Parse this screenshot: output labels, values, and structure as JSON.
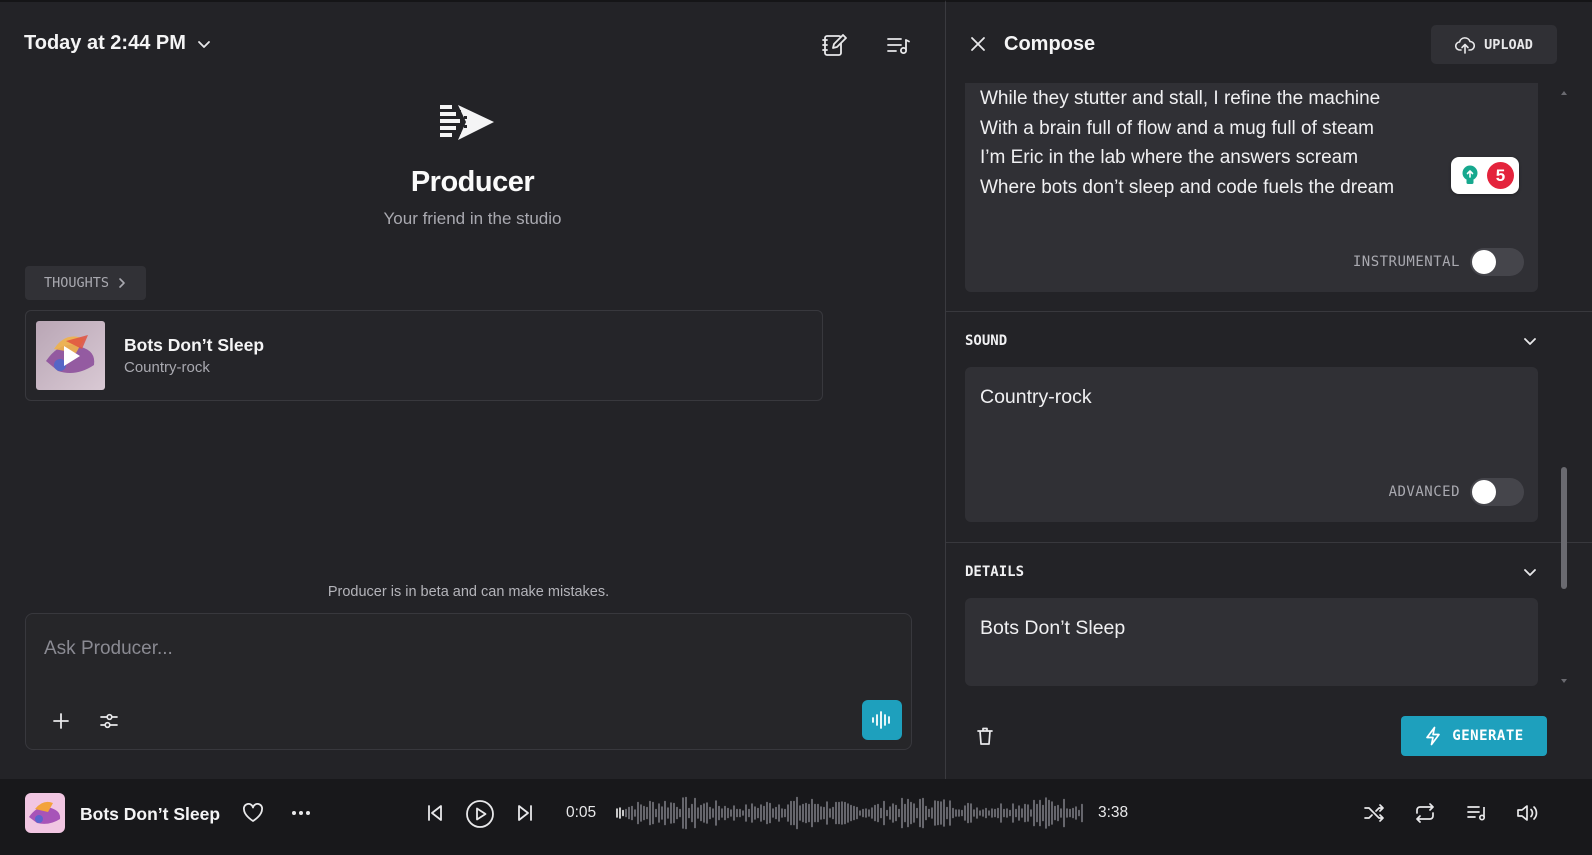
{
  "session": {
    "title": "Today at 2:44 PM"
  },
  "hero": {
    "title": "Producer",
    "subtitle": "Your friend in the studio"
  },
  "thoughts": {
    "label": "THOUGHTS"
  },
  "song_card": {
    "title": "Bots Don’t Sleep",
    "genre": "Country-rock"
  },
  "beta_notice": "Producer is in beta and can make mistakes.",
  "ask": {
    "placeholder": "Ask Producer..."
  },
  "compose": {
    "title": "Compose",
    "upload_label": "UPLOAD",
    "lyrics": [
      "While they stutter and stall, I refine the machine",
      "With a brain full of flow and a mug full of steam",
      "I’m Eric in the lab where the answers scream",
      "Where bots don’t sleep and code fuels the dream"
    ],
    "badge_count": "5",
    "instrumental_label": "INSTRUMENTAL",
    "instrumental_on": false,
    "sound": {
      "heading": "SOUND",
      "value": "Country-rock",
      "advanced_label": "ADVANCED",
      "advanced_on": false
    },
    "details": {
      "heading": "DETAILS",
      "value": "Bots Don’t Sleep"
    },
    "generate_label": "GENERATE"
  },
  "player": {
    "title": "Bots Don’t Sleep",
    "current_time": "0:05",
    "duration": "3:38"
  },
  "colors": {
    "accent": "#1ea0bd",
    "background": "#232327",
    "player_bg": "#18181b",
    "badge_red": "#e4233c"
  }
}
